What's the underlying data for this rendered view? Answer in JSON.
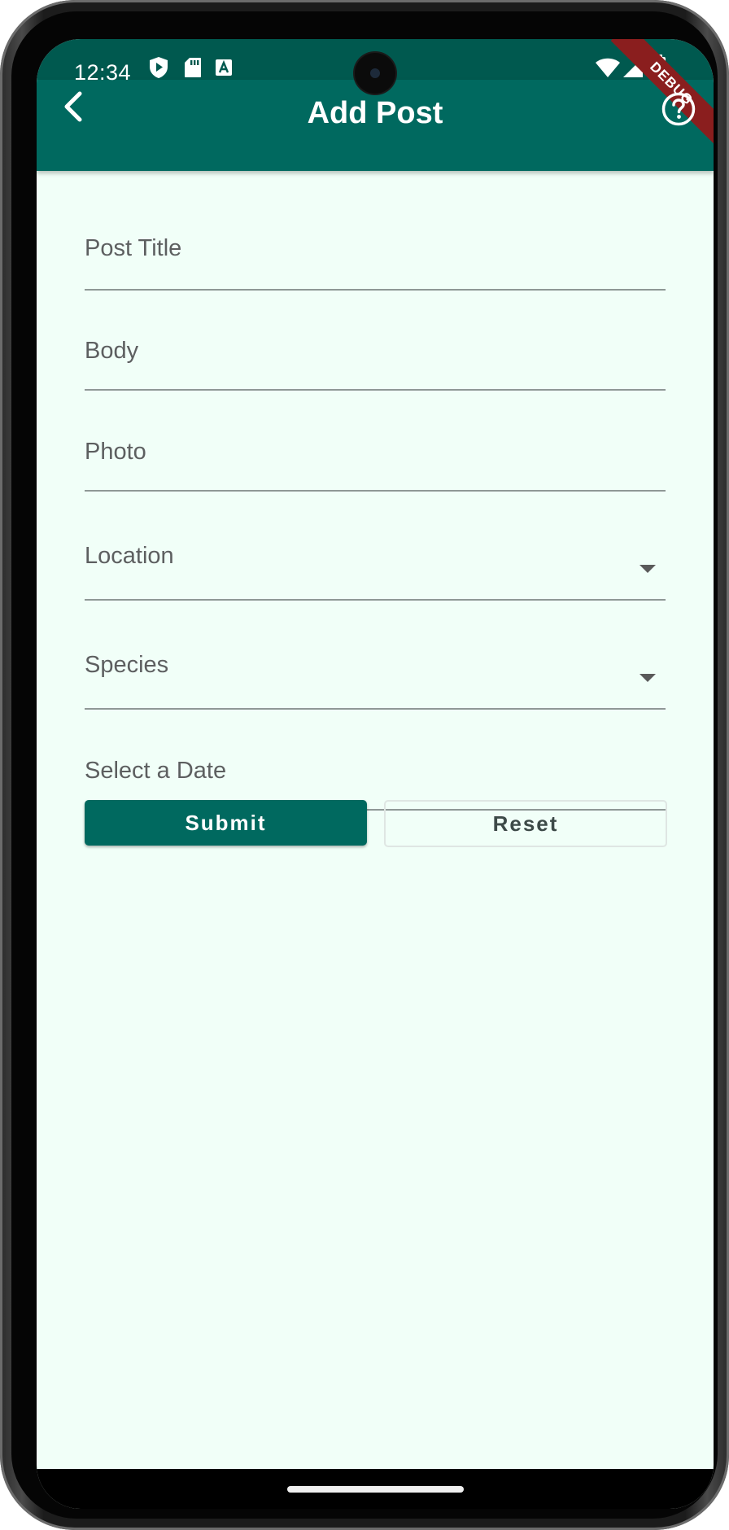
{
  "status_bar": {
    "time": "12:34",
    "icons": [
      "shield-play-icon",
      "sd-card-icon",
      "a-box-icon",
      "wifi-icon",
      "signal-icon",
      "battery-icon"
    ]
  },
  "debug_banner": "DEBUG",
  "app_bar": {
    "title": "Add Post",
    "back_icon": "chevron-left-icon",
    "help_icon": "help-circle-icon"
  },
  "form": {
    "post_title_label": "Post Title",
    "body_label": "Body",
    "photo_label": "Photo",
    "location_label": "Location",
    "species_label": "Species",
    "date_label": "Select a Date"
  },
  "buttons": {
    "submit": "Submit",
    "reset": "Reset"
  },
  "colors": {
    "app_bar": "#00695f",
    "status_bar": "#00594f",
    "background": "#f1fff8",
    "submit_button": "#00695f"
  }
}
